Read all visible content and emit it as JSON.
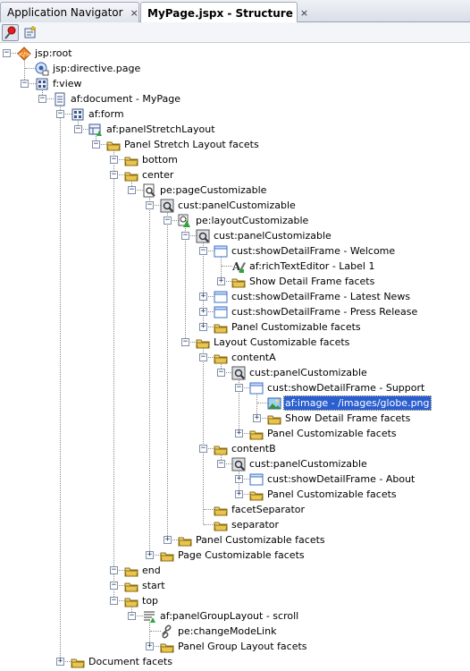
{
  "tabs": [
    {
      "label": "Application Navigator",
      "close": "×",
      "icon": "navigator-icon",
      "active": false
    },
    {
      "label": "MyPage.jspx - Structure",
      "close": "×",
      "icon": "structure-icon",
      "active": true
    }
  ],
  "toolbar": [
    {
      "name": "freeze-view-button",
      "icon": "pin-icon"
    },
    {
      "name": "new-view-button",
      "icon": "new-view-icon"
    }
  ],
  "tree": [
    {
      "d": 0,
      "t": "jsp:root",
      "i": "jsp",
      "x": "-"
    },
    {
      "d": 1,
      "t": "jsp:directive.page",
      "i": "directive",
      "x": ""
    },
    {
      "d": 1,
      "t": "f:view",
      "i": "comp",
      "x": "-"
    },
    {
      "d": 2,
      "t": "af:document - MyPage",
      "i": "doc",
      "x": "-"
    },
    {
      "d": 3,
      "t": "af:form",
      "i": "comp",
      "x": "-"
    },
    {
      "d": 4,
      "t": "af:panelStretchLayout",
      "i": "layout",
      "x": "-"
    },
    {
      "d": 5,
      "t": "Panel Stretch Layout facets",
      "i": "folder",
      "x": "-"
    },
    {
      "d": 6,
      "t": "bottom",
      "i": "folder",
      "x": "-"
    },
    {
      "d": 6,
      "t": "center",
      "i": "folder",
      "x": "-"
    },
    {
      "d": 7,
      "t": "pe:pageCustomizable",
      "i": "cust",
      "x": "-"
    },
    {
      "d": 8,
      "t": "cust:panelCustomizable",
      "i": "panel",
      "x": "-"
    },
    {
      "d": 9,
      "t": "pe:layoutCustomizable",
      "i": "layoutc",
      "x": "-"
    },
    {
      "d": 10,
      "t": "cust:panelCustomizable",
      "i": "panel",
      "x": "-"
    },
    {
      "d": 11,
      "t": "cust:showDetailFrame - Welcome",
      "i": "frame",
      "x": "-"
    },
    {
      "d": 12,
      "t": "af:richTextEditor - Label 1",
      "i": "rte",
      "x": ""
    },
    {
      "d": 12,
      "t": "Show Detail Frame facets",
      "i": "folder",
      "x": "+"
    },
    {
      "d": 11,
      "t": "cust:showDetailFrame - Latest News",
      "i": "frame",
      "x": "+"
    },
    {
      "d": 11,
      "t": "cust:showDetailFrame - Press Release",
      "i": "frame",
      "x": "+"
    },
    {
      "d": 11,
      "t": "Panel Customizable facets",
      "i": "folder",
      "x": "+"
    },
    {
      "d": 10,
      "t": "Layout Customizable facets",
      "i": "folder",
      "x": "-"
    },
    {
      "d": 11,
      "t": "contentA",
      "i": "folder",
      "x": "-"
    },
    {
      "d": 12,
      "t": "cust:panelCustomizable",
      "i": "panel",
      "x": "-"
    },
    {
      "d": 13,
      "t": "cust:showDetailFrame - Support",
      "i": "frame",
      "x": "-"
    },
    {
      "d": 14,
      "t": "af:image - /images/globe.png",
      "i": "image",
      "x": "",
      "sel": true
    },
    {
      "d": 14,
      "t": "Show Detail Frame facets",
      "i": "folder",
      "x": "+"
    },
    {
      "d": 13,
      "t": "Panel Customizable facets",
      "i": "folder",
      "x": "+"
    },
    {
      "d": 11,
      "t": "contentB",
      "i": "folder",
      "x": "-"
    },
    {
      "d": 12,
      "t": "cust:panelCustomizable",
      "i": "panel",
      "x": "-"
    },
    {
      "d": 13,
      "t": "cust:showDetailFrame - About",
      "i": "frame",
      "x": "+"
    },
    {
      "d": 13,
      "t": "Panel Customizable facets",
      "i": "folder",
      "x": "+"
    },
    {
      "d": 11,
      "t": "facetSeparator",
      "i": "folder",
      "x": ""
    },
    {
      "d": 11,
      "t": "separator",
      "i": "folder",
      "x": ""
    },
    {
      "d": 9,
      "t": "Panel Customizable facets",
      "i": "folder",
      "x": "+"
    },
    {
      "d": 8,
      "t": "Page Customizable facets",
      "i": "folder",
      "x": "+"
    },
    {
      "d": 6,
      "t": "end",
      "i": "folder",
      "x": "-"
    },
    {
      "d": 6,
      "t": "start",
      "i": "folder",
      "x": "-"
    },
    {
      "d": 6,
      "t": "top",
      "i": "folder",
      "x": "-"
    },
    {
      "d": 7,
      "t": "af:panelGroupLayout - scroll",
      "i": "pgl",
      "x": "-"
    },
    {
      "d": 8,
      "t": "pe:changeModeLink",
      "i": "link",
      "x": ""
    },
    {
      "d": 8,
      "t": "Panel Group Layout facets",
      "i": "folder",
      "x": "+"
    },
    {
      "d": 3,
      "t": "Document facets",
      "i": "folder",
      "x": "+"
    }
  ]
}
